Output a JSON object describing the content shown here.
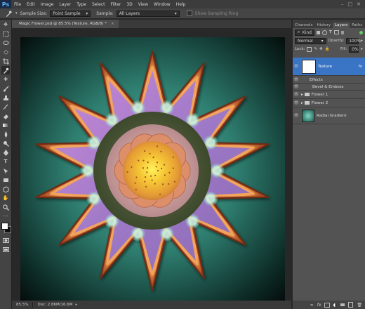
{
  "app": {
    "logo": "Ps"
  },
  "menu": [
    "File",
    "Edit",
    "Image",
    "Layer",
    "Type",
    "Select",
    "Filter",
    "3D",
    "View",
    "Window",
    "Help"
  ],
  "window_controls": [
    "–",
    "□",
    "✕"
  ],
  "options_bar": {
    "sample_size_label": "Sample Size:",
    "sample_size_value": "Point Sample",
    "sample_label": "Sample:",
    "sample_value": "All Layers",
    "sampling_ring_label": "Show Sampling Ring"
  },
  "document": {
    "tab_title": "Magic Flower.psd @ 85.5% (Texture, RGB/8) *"
  },
  "status": {
    "zoom": "85.5%",
    "doc_info": "Doc: 2.86M/16.6M"
  },
  "panel": {
    "tabs": [
      "Channels",
      "History",
      "Layers",
      "Paths"
    ],
    "active_tab": "Layers",
    "filter_kind": "Kind",
    "blend_mode": "Normal",
    "opacity_label": "Opacity:",
    "opacity_value": "100%",
    "lock_label": "Lock:",
    "fill_label": "Fill:",
    "fill_value": "0%"
  },
  "layers": [
    {
      "name": "Texture",
      "fx": "fx"
    },
    {
      "name": "Effects"
    },
    {
      "name": "Bevel & Emboss"
    },
    {
      "name": "Flower 1"
    },
    {
      "name": "Flower 2"
    },
    {
      "name": "Radial Gradient"
    }
  ],
  "colors": {
    "accent": "#3a74c4",
    "canvas_teal": "#2e7e70"
  }
}
